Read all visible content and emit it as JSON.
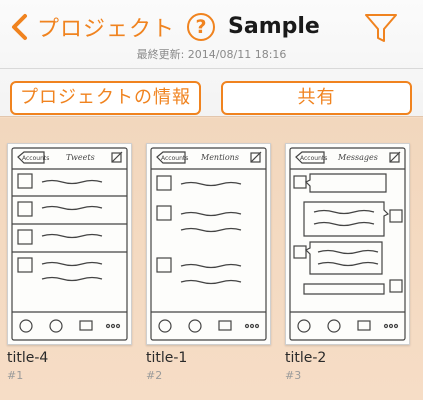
{
  "header": {
    "back_label": "プロジェクト",
    "help_label": "?",
    "title": "Sample",
    "updated_label": "最終更新: 2014/08/11 18:16"
  },
  "buttons": {
    "project_info": "プロジェクトの情報",
    "share": "共有"
  },
  "icons": {
    "back": "chevron-left-icon",
    "help": "help-icon",
    "filter": "filter-icon"
  },
  "colors": {
    "accent": "#f0831f",
    "background": "#f5dcc4"
  },
  "cards": [
    {
      "title": "title-4",
      "number": "#1",
      "sketch_back": "Accounts",
      "sketch_title": "Tweets"
    },
    {
      "title": "title-1",
      "number": "#2",
      "sketch_back": "Accounts",
      "sketch_title": "Mentions"
    },
    {
      "title": "title-2",
      "number": "#3",
      "sketch_back": "Accounts",
      "sketch_title": "Messages"
    }
  ]
}
